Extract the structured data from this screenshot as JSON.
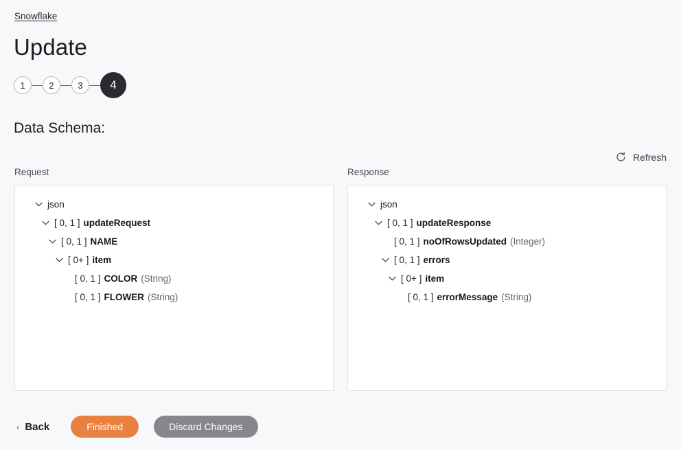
{
  "breadcrumb": {
    "label": "Snowflake"
  },
  "header": {
    "title": "Update"
  },
  "stepper": {
    "steps": [
      {
        "label": "1",
        "active": false
      },
      {
        "label": "2",
        "active": false
      },
      {
        "label": "3",
        "active": false
      },
      {
        "label": "4",
        "active": true
      }
    ]
  },
  "section": {
    "title": "Data Schema:"
  },
  "toolbar": {
    "refresh_label": "Refresh",
    "refresh_icon": "refresh-icon"
  },
  "columns": {
    "request_label": "Request",
    "response_label": "Response"
  },
  "request_tree": [
    {
      "depth": 0,
      "chevron": true,
      "cardinality": "",
      "name": "json",
      "type": "",
      "bold": false
    },
    {
      "depth": 1,
      "chevron": true,
      "cardinality": "[ 0, 1 ]",
      "name": "updateRequest",
      "type": "",
      "bold": true
    },
    {
      "depth": 2,
      "chevron": true,
      "cardinality": "[ 0, 1 ]",
      "name": "NAME",
      "type": "",
      "bold": true
    },
    {
      "depth": 3,
      "chevron": true,
      "cardinality": "[ 0+ ]",
      "name": "item",
      "type": "",
      "bold": true
    },
    {
      "depth": 4,
      "chevron": false,
      "cardinality": "[ 0, 1 ]",
      "name": "COLOR",
      "type": "(String)",
      "bold": true
    },
    {
      "depth": 4,
      "chevron": false,
      "cardinality": "[ 0, 1 ]",
      "name": "FLOWER",
      "type": "(String)",
      "bold": true
    }
  ],
  "response_tree": [
    {
      "depth": 0,
      "chevron": true,
      "cardinality": "",
      "name": "json",
      "type": "",
      "bold": false
    },
    {
      "depth": 1,
      "chevron": true,
      "cardinality": "[ 0, 1 ]",
      "name": "updateResponse",
      "type": "",
      "bold": true
    },
    {
      "depth": 2,
      "chevron": false,
      "cardinality": "[ 0, 1 ]",
      "name": "noOfRowsUpdated",
      "type": "(Integer)",
      "bold": true
    },
    {
      "depth": 2,
      "chevron": true,
      "cardinality": "[ 0, 1 ]",
      "name": "errors",
      "type": "",
      "bold": true
    },
    {
      "depth": 3,
      "chevron": true,
      "cardinality": "[ 0+ ]",
      "name": "item",
      "type": "",
      "bold": true
    },
    {
      "depth": 4,
      "chevron": false,
      "cardinality": "[ 0, 1 ]",
      "name": "errorMessage",
      "type": "(String)",
      "bold": true
    }
  ],
  "footer": {
    "back_label": "Back",
    "back_chevron": "‹",
    "finished_label": "Finished",
    "discard_label": "Discard Changes"
  },
  "colors": {
    "page_background": "#f7f8fa",
    "panel_background": "#ffffff",
    "panel_border": "#e3e3e8",
    "accent_orange": "#e8803f",
    "neutral_gray": "#87868c",
    "step_active": "#2b2a31"
  }
}
